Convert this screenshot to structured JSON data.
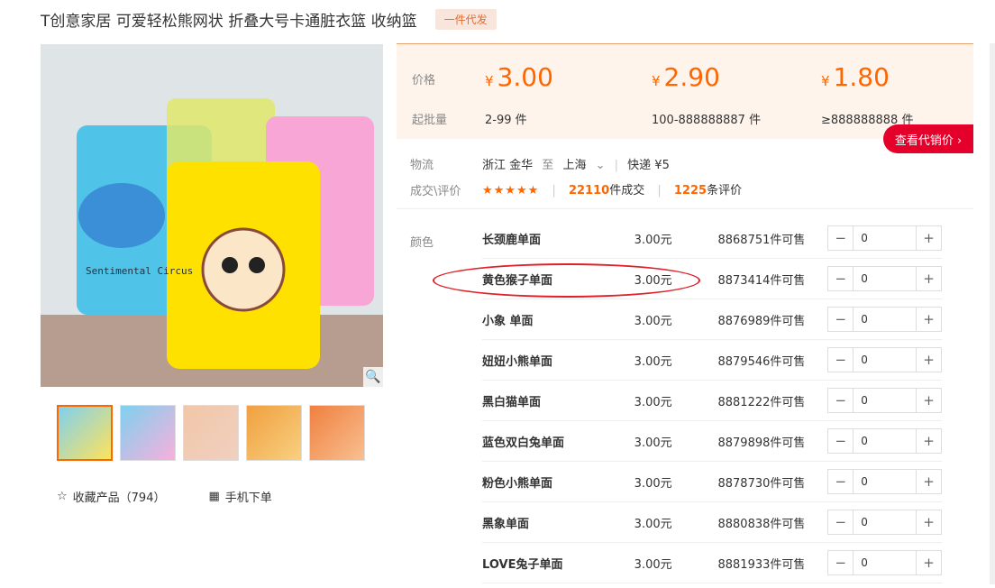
{
  "title": "T创意家居 可爱轻松熊网状 折叠大号卡通脏衣篮 收纳篮",
  "badge": "一件代发",
  "prices": {
    "label_price": "价格",
    "label_qty": "起批量",
    "tiers": [
      {
        "currency": "¥",
        "price": "3.00",
        "range": "2-99 件"
      },
      {
        "currency": "¥",
        "price": "2.90",
        "range": "100-888888887 件"
      },
      {
        "currency": "¥",
        "price": "1.80",
        "range": "≥888888888 件"
      }
    ]
  },
  "agent_button": "查看代销价 ›",
  "logistics": {
    "label": "物流",
    "from": "浙江 金华",
    "to_word": "至",
    "dest": "上海",
    "dropdown": "⌄",
    "shipping": "快递 ¥5"
  },
  "deals": {
    "label": "成交\\评价",
    "stars": "★★★★★",
    "sold_num": "22110",
    "sold_suffix": "件成交",
    "reviews_num": "1225",
    "reviews_suffix": "条评价"
  },
  "color_label": "颜色",
  "skus": [
    {
      "name": "长颈鹿单面",
      "price": "3.00元",
      "stock": "8868751件可售",
      "qty": "0"
    },
    {
      "name": "黄色猴子单面",
      "price": "3.00元",
      "stock": "8873414件可售",
      "qty": "0"
    },
    {
      "name": "小象 单面",
      "price": "3.00元",
      "stock": "8876989件可售",
      "qty": "0"
    },
    {
      "name": "妞妞小熊单面",
      "price": "3.00元",
      "stock": "8879546件可售",
      "qty": "0"
    },
    {
      "name": "黑白猫单面",
      "price": "3.00元",
      "stock": "8881222件可售",
      "qty": "0"
    },
    {
      "name": "蓝色双白兔单面",
      "price": "3.00元",
      "stock": "8879898件可售",
      "qty": "0"
    },
    {
      "name": "粉色小熊单面",
      "price": "3.00元",
      "stock": "8878730件可售",
      "qty": "0"
    },
    {
      "name": "黑象单面",
      "price": "3.00元",
      "stock": "8880838件可售",
      "qty": "0"
    },
    {
      "name": "LOVE兔子单面",
      "price": "3.00元",
      "stock": "8881933件可售",
      "qty": "0"
    }
  ],
  "image_text": "Sentimental Circus",
  "favorite": "收藏产品（794）",
  "mobile": "手机下单",
  "colors": {
    "accent": "#ff6600",
    "red": "#e4002b"
  }
}
